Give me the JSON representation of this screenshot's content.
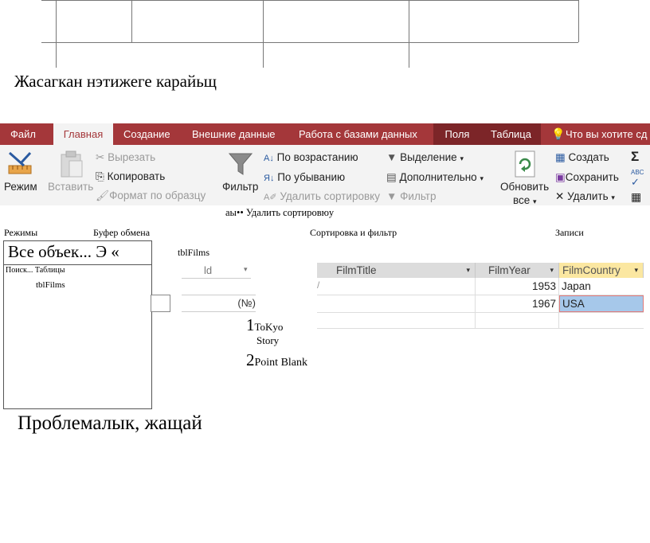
{
  "caption_top": "Жасагкан нэтижеге карайьщ",
  "caption_bottom": "Проблемалык, жащай",
  "tabs": [
    {
      "label": "Файл"
    },
    {
      "label": "Главная"
    },
    {
      "label": "Создание"
    },
    {
      "label": "Внешние данные"
    },
    {
      "label": "Работа с базами данных"
    },
    {
      "label": "Поля"
    },
    {
      "label": "Таблица"
    },
    {
      "label": "Что вы хотите сд"
    }
  ],
  "ribbon": {
    "mode_label": "Режим",
    "paste_label": "Вставить",
    "cut_label": "Вырезать",
    "copy_label": "Копировать",
    "format_painter_label": "Формат по образцу",
    "filter_label": "Фильтр",
    "sort_asc_label": "По возрастанию",
    "sort_desc_label": "По убыванию",
    "remove_sort_label": "Удалить сортировку",
    "selection_label": "Выделение",
    "advanced_label": "Дополнительно",
    "toggle_filter_label": "Фильтр",
    "refresh_label": "Обновить",
    "refresh_label2": "все",
    "new_label": "Создать",
    "save_label": "Сохранить",
    "delete_label": "Удалить",
    "sigma_label": "Σ",
    "abc_label": "ABC",
    "overlay_note": "аы•• Удалить сортировюу"
  },
  "groups": {
    "modes": "Режимы",
    "clipboard": "Буфер обмена",
    "sort_filter": "Сортировка и фильтр",
    "records": "Записи"
  },
  "nav": {
    "title": "Все объек... Э «",
    "search": "Поиск...",
    "section": "Таблицы",
    "item": "tblFilms"
  },
  "doc_tab": "tblFilms",
  "grid": {
    "id_header": "ld",
    "headers": [
      "FilmTitle",
      "FilmYear",
      "FilmCountry"
    ],
    "rows": [
      {
        "year": "1953",
        "country": "Japan"
      },
      {
        "year": "1967",
        "country": "USA"
      }
    ],
    "new_row_id": "(№)"
  },
  "overlay_titles": [
    {
      "num": "1",
      "title": "ToKyo",
      "title2": "Story"
    },
    {
      "num": "2",
      "title": "Point Blank"
    }
  ]
}
